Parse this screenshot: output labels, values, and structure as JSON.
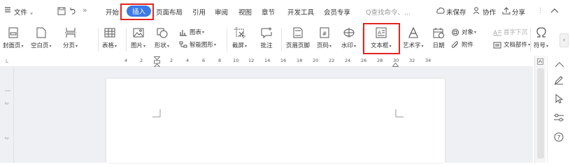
{
  "menubar": {
    "menu_icon": "hamburger-icon",
    "file_label": "文件",
    "tabs": [
      "开始",
      "插入",
      "页面布局",
      "引用",
      "审阅",
      "视图",
      "章节",
      "开发工具",
      "会员专享"
    ],
    "active_tab": "插入",
    "search_placeholder": "Q查找命令、...",
    "unsaved_label": "未保存",
    "collab_label": "协作",
    "share_label": "分享"
  },
  "ribbon": {
    "cover_page": "封面页",
    "blank_page": "空白页",
    "page_break": "分页",
    "table": "表格",
    "picture": "图片",
    "shape": "形状",
    "chart": "图表",
    "smart_art": "智能图形",
    "screenshot": "截屏",
    "comment": "批注",
    "header_footer": "页眉页脚",
    "page_number": "页码",
    "watermark": "水印",
    "textbox": "文本框",
    "wordart": "艺术字",
    "date": "日期",
    "object": "对象",
    "attachment": "附件",
    "drop_cap": "首字下沉",
    "doc_parts": "文档部件",
    "symbol": "符号"
  },
  "ruler": {
    "ticks": [
      "4",
      "2",
      "2",
      "4",
      "6",
      "8",
      "10",
      "12",
      "14",
      "16",
      "18",
      "20",
      "22",
      "24",
      "26",
      "28",
      "30",
      "32",
      "34"
    ]
  },
  "highlight_color": "#e0261f",
  "accent_color": "#3b7ae6"
}
